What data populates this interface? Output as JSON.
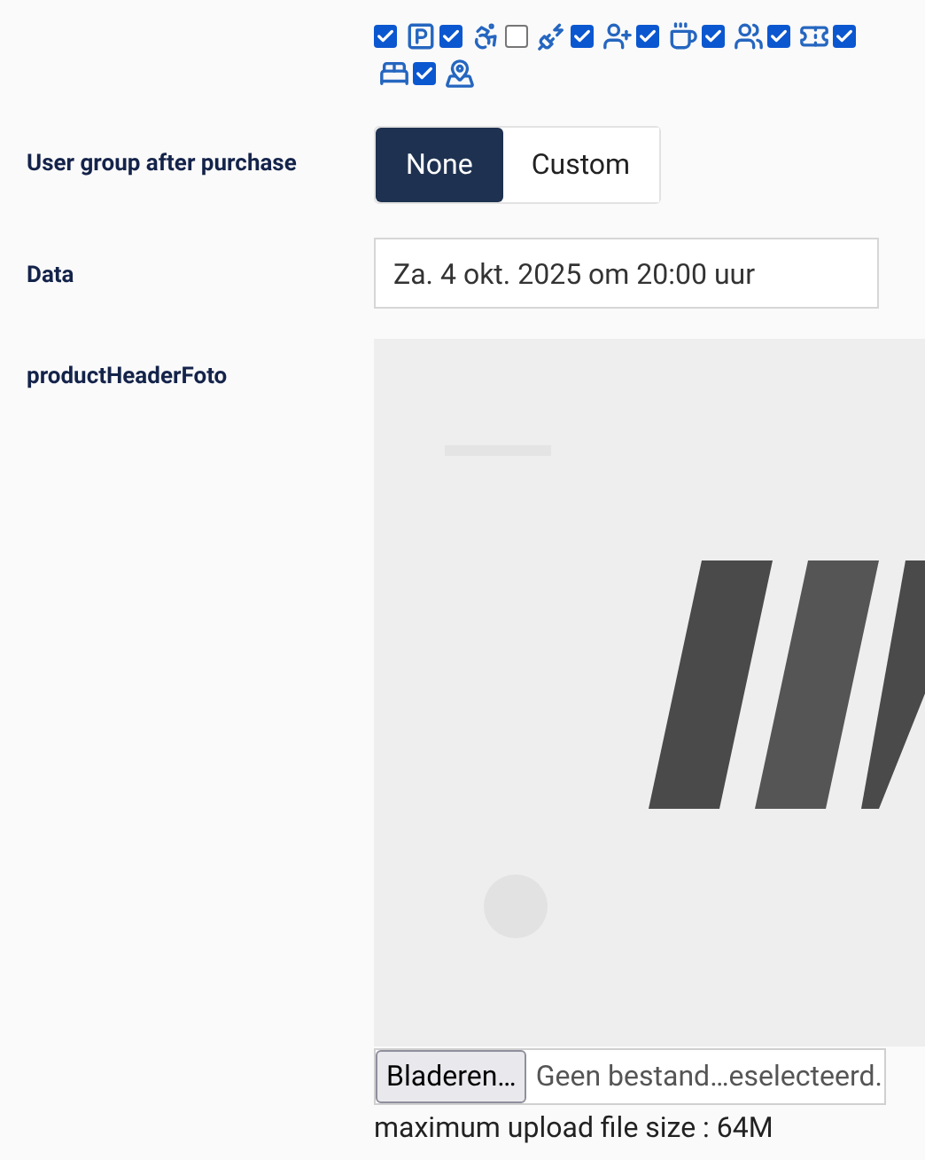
{
  "amenities": [
    {
      "kind": "checkbox",
      "checked": true
    },
    {
      "kind": "parking"
    },
    {
      "kind": "checkbox",
      "checked": true
    },
    {
      "kind": "wheelchair"
    },
    {
      "kind": "checkbox",
      "checked": false
    },
    {
      "kind": "charging"
    },
    {
      "kind": "checkbox",
      "checked": true
    },
    {
      "kind": "person-add"
    },
    {
      "kind": "checkbox",
      "checked": true
    },
    {
      "kind": "coffee"
    },
    {
      "kind": "checkbox",
      "checked": true
    },
    {
      "kind": "restroom"
    },
    {
      "kind": "checkbox",
      "checked": true
    },
    {
      "kind": "ticket"
    },
    {
      "kind": "checkbox",
      "checked": true
    },
    {
      "kind": "bed"
    },
    {
      "kind": "checkbox",
      "checked": true
    },
    {
      "kind": "map"
    }
  ],
  "user_group": {
    "label": "User group after purchase",
    "options": [
      {
        "label": "None",
        "selected": true
      },
      {
        "label": "Custom",
        "selected": false
      }
    ]
  },
  "data": {
    "label": "Data",
    "value": "Za. 4 okt. 2025 om 20:00 uur"
  },
  "header_photo": {
    "label": "productHeaderFoto",
    "browse_button": "Bladeren…",
    "file_status": "Geen bestand…eselecteerd.",
    "hint": "maximum upload file size : 64M"
  }
}
